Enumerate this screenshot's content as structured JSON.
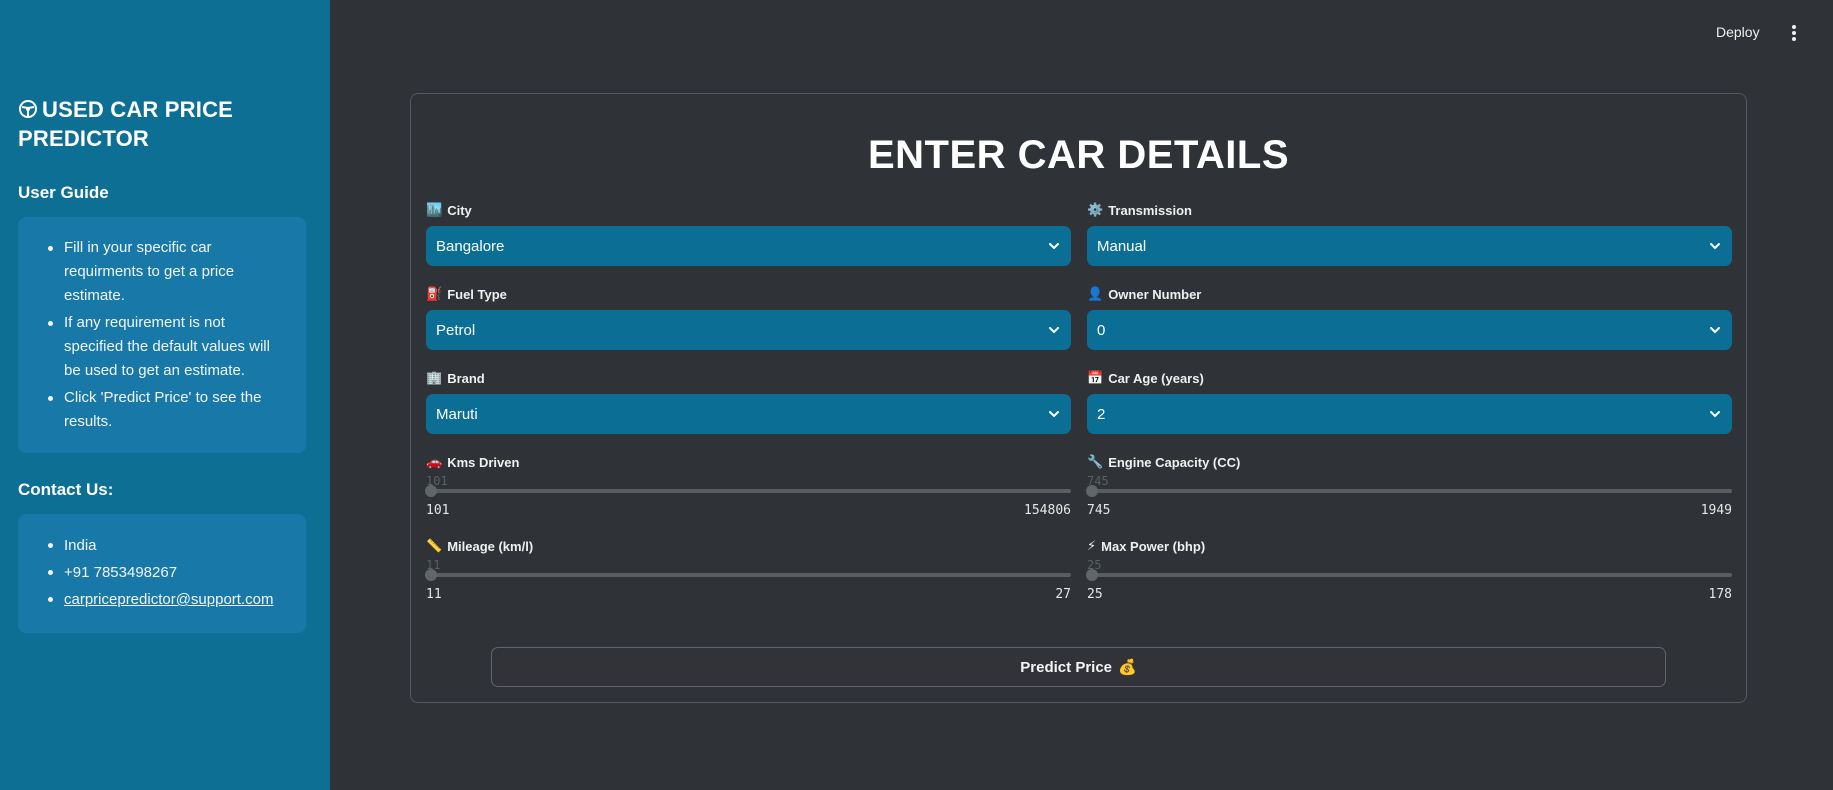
{
  "sidebar": {
    "title": "USED CAR PRICE PREDICTOR",
    "guide_heading": "User Guide",
    "guide_items": [
      "Fill in your specific car requirments to get a price estimate.",
      "If any requirement is not specified the default values will be used to get an estimate.",
      "Click 'Predict Price' to see the results."
    ],
    "contact_heading": "Contact Us:",
    "contact": {
      "country": "India",
      "phone": "+91 7853498267",
      "email": "carpricepredictor@support.com"
    }
  },
  "header": {
    "deploy_label": "Deploy"
  },
  "form": {
    "title": "ENTER CAR DETAILS",
    "city": {
      "label": "City",
      "icon": "🏙️",
      "value": "Bangalore"
    },
    "transmission": {
      "label": "Transmission",
      "icon": "⚙️",
      "value": "Manual"
    },
    "fuel": {
      "label": "Fuel Type",
      "icon": "⛽",
      "value": "Petrol"
    },
    "owner": {
      "label": "Owner Number",
      "icon": "👤",
      "value": "0"
    },
    "brand": {
      "label": "Brand",
      "icon": "🏢",
      "value": "Maruti"
    },
    "age": {
      "label": "Car Age (years)",
      "icon": "📅",
      "value": "2"
    },
    "kms": {
      "label": "Kms Driven",
      "icon": "🚗",
      "current": "101",
      "min": "101",
      "max": "154806"
    },
    "engine": {
      "label": "Engine Capacity (CC)",
      "icon": "🔧",
      "current": "745",
      "min": "745",
      "max": "1949"
    },
    "mileage": {
      "label": "Mileage (km/l)",
      "icon": "📏",
      "current": "11",
      "min": "11",
      "max": "27"
    },
    "power": {
      "label": "Max Power (bhp)",
      "icon": "⚡",
      "current": "25",
      "min": "25",
      "max": "178"
    },
    "predict_label": "Predict Price",
    "predict_icon": "💰"
  },
  "colors": {
    "sidebar_bg": "#0d6f93",
    "guide_box_bg": "#1879a8",
    "main_bg": "#2f3236",
    "select_bg": "#0b6e94"
  }
}
